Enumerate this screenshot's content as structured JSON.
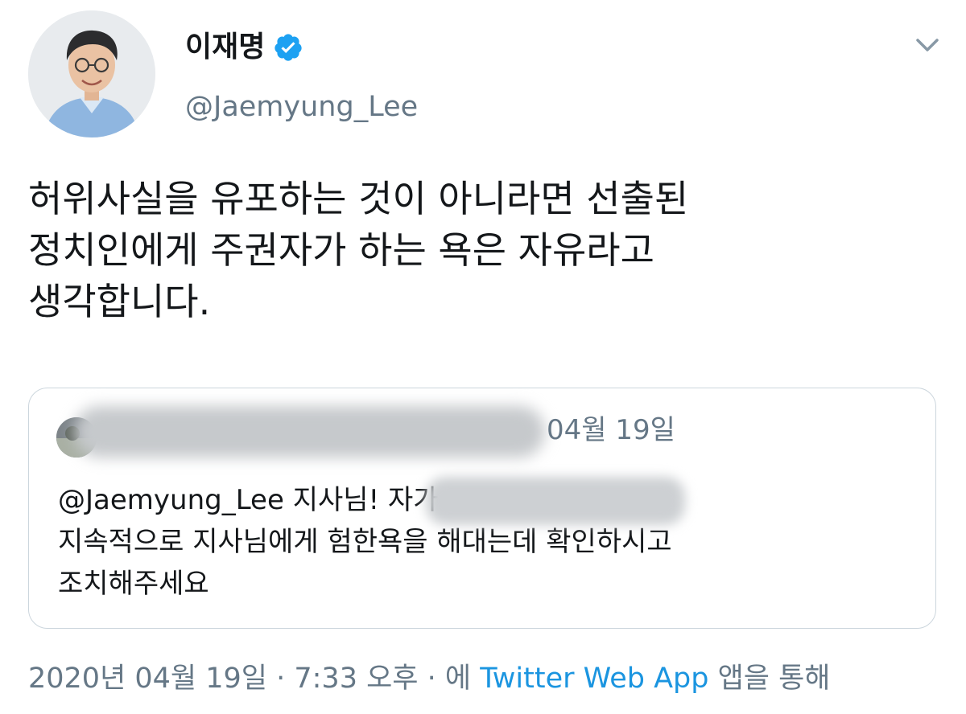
{
  "tweet": {
    "author": {
      "display_name": "이재명",
      "handle": "@Jaemyung_Lee",
      "verified": true,
      "avatar_icon": "profile-photo"
    },
    "text": "허위사실을 유포하는 것이 아니라면 선출된\n정치인에게 주권자가 하는 욕은 자유라고\n생각합니다.",
    "quoted_tweet": {
      "date": "04월 19일",
      "text": "@Jaemyung_Lee 지사님!                      자가\n지속적으로 지사님에게 험한욕을 해대는데 확인하시고\n조치해주세요"
    },
    "meta": {
      "timestamp": "2020년 04월 19일 · 7:33 오후 · 에 ",
      "source_app": "Twitter Web App",
      "source_suffix": " 앱을 통해"
    }
  },
  "colors": {
    "verified": "#1da1f2",
    "link": "#1b95e0",
    "secondary_text": "#657786",
    "border": "#ccd6dd"
  }
}
